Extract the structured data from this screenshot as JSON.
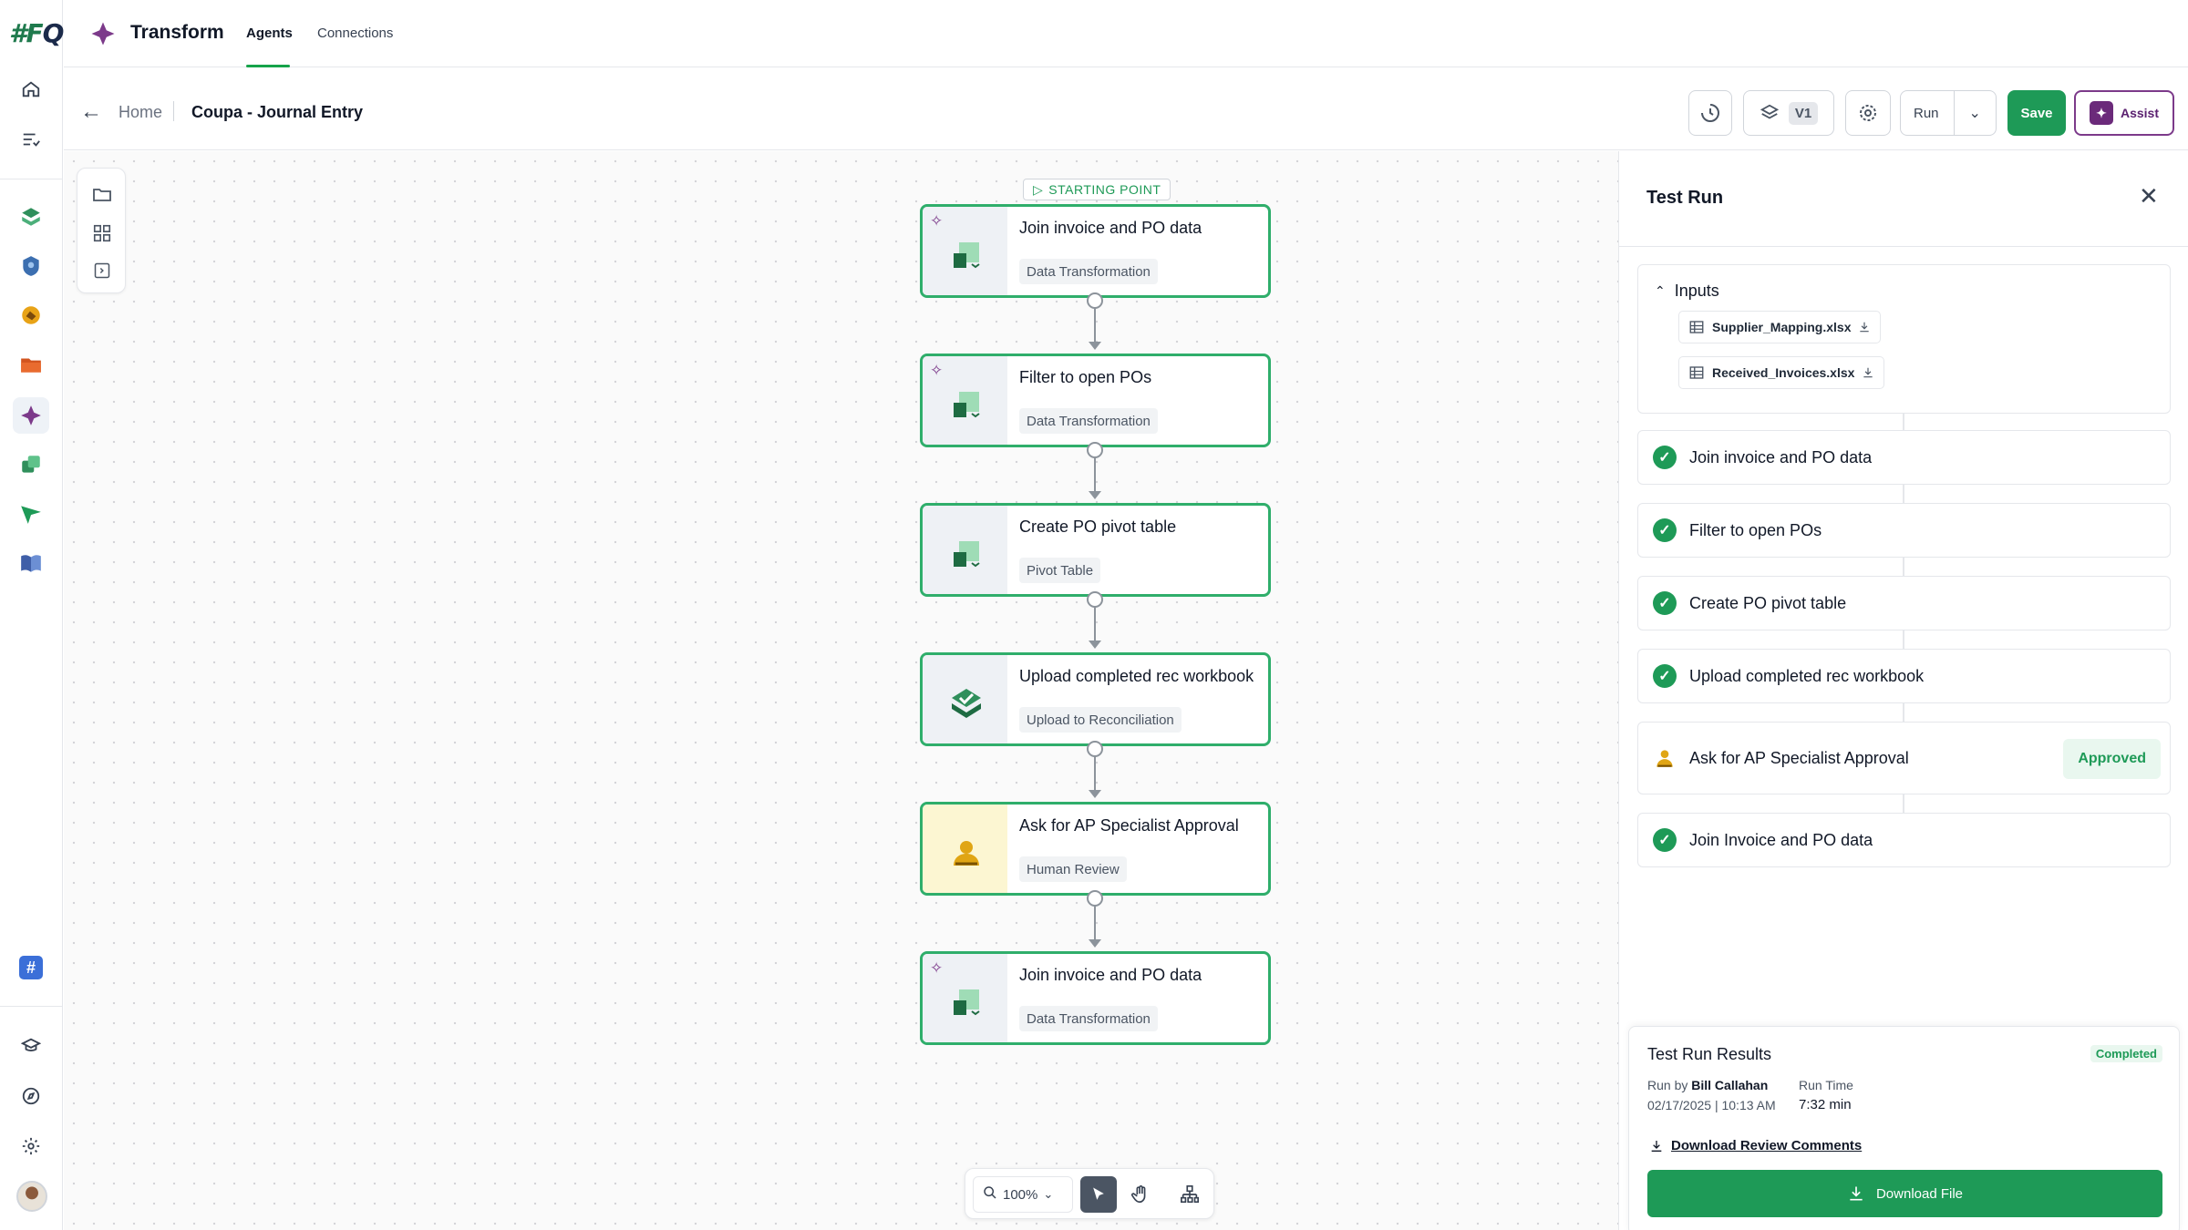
{
  "app": {
    "logo": "#FQ",
    "title": "Transform"
  },
  "top_tabs": [
    {
      "label": "Agents",
      "active": true
    },
    {
      "label": "Connections",
      "active": false
    }
  ],
  "breadcrumb": {
    "home": "Home",
    "current": "Coupa - Journal Entry"
  },
  "toolbar": {
    "version_label": "V1",
    "run_label": "Run",
    "save_label": "Save",
    "assist_label": "Assist"
  },
  "canvas": {
    "starting_point_label": "STARTING POINT",
    "nodes": [
      {
        "title": "Join invoice and PO data",
        "type": "Data Transformation",
        "icon": "data-transform-icon"
      },
      {
        "title": "Filter to open POs",
        "type": "Data Transformation",
        "icon": "data-transform-icon"
      },
      {
        "title": "Create PO pivot table",
        "type": "Pivot Table",
        "icon": "pivot-table-icon"
      },
      {
        "title": "Upload completed rec workbook",
        "type": "Upload to Reconciliation",
        "icon": "upload-reconciliation-icon"
      },
      {
        "title": "Ask for AP Specialist Approval",
        "type": "Human Review",
        "icon": "human-review-icon"
      },
      {
        "title": "Join invoice and PO data",
        "type": "Data Transformation",
        "icon": "data-transform-icon"
      }
    ],
    "zoom": "100%"
  },
  "test_run": {
    "title": "Test Run",
    "inputs_label": "Inputs",
    "files": [
      "Supplier_Mapping.xlsx",
      "Received_Invoices.xlsx"
    ],
    "steps": [
      {
        "label": "Join invoice and PO data",
        "status": "done"
      },
      {
        "label": "Filter to open POs",
        "status": "done"
      },
      {
        "label": "Create PO pivot table",
        "status": "done"
      },
      {
        "label": "Upload completed rec workbook",
        "status": "done"
      },
      {
        "label": "Ask for AP Specialist Approval",
        "status": "Approved"
      },
      {
        "label": "Join Invoice and PO data",
        "status": "done"
      }
    ],
    "results": {
      "title": "Test Run Results",
      "status": "Completed",
      "run_by_label": "Run by",
      "run_by": "Bill Callahan",
      "timestamp": "02/17/2025 | 10:13 AM",
      "run_time_label": "Run Time",
      "run_time": "7:32 min",
      "download_comments": "Download Review Comments",
      "download_file": "Download File"
    }
  },
  "colors": {
    "accent": "#1e9a57",
    "node_border": "#2fae6b",
    "assist": "#7c3a8a"
  }
}
